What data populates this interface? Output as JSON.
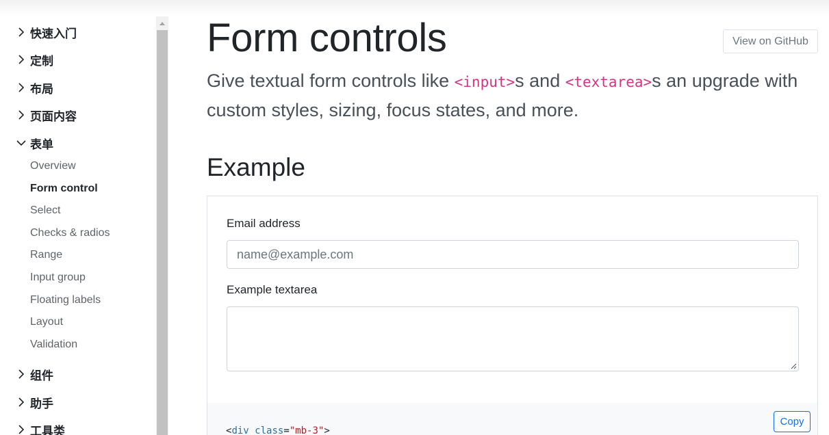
{
  "sidebar": {
    "groups": [
      {
        "label": "快速入门",
        "expanded": false
      },
      {
        "label": "定制",
        "expanded": false
      },
      {
        "label": "布局",
        "expanded": false
      },
      {
        "label": "页面内容",
        "expanded": false
      },
      {
        "label": "表单",
        "expanded": true
      },
      {
        "label": "组件",
        "expanded": false
      },
      {
        "label": "助手",
        "expanded": false
      },
      {
        "label": "工具类",
        "expanded": false
      }
    ],
    "form_items": [
      "Overview",
      "Form control",
      "Select",
      "Checks & radios",
      "Range",
      "Input group",
      "Floating labels",
      "Layout",
      "Validation"
    ],
    "active_item": "Form control"
  },
  "page": {
    "title": "Form controls",
    "github_label": "View on GitHub",
    "lead": {
      "part1": "Give textual form controls like ",
      "code1": "<input>",
      "part2": "s and ",
      "code2": "<textarea>",
      "part3": "s an upgrade with custom styles, sizing, focus states, and more."
    },
    "section_heading": "Example"
  },
  "example": {
    "email_label": "Email address",
    "email_placeholder": "name@example.com",
    "email_value": "",
    "textarea_label": "Example textarea",
    "textarea_value": ""
  },
  "code": {
    "copy_label": "Copy",
    "line_open": "<",
    "line_tag": "div",
    "line_attr": " class",
    "line_eq": "=",
    "line_value": "\"mb-3\"",
    "line_close": ">"
  },
  "colors": {
    "accent": "#0d6efd",
    "code_pink": "#d63384",
    "text": "#212529",
    "muted": "#6c757d"
  },
  "icons": {
    "collapsed": "chevron-right-icon",
    "expanded": "chevron-down-icon",
    "scroll_up": "scroll-up-arrow-icon",
    "textarea_grip": "resize-grip-icon"
  }
}
